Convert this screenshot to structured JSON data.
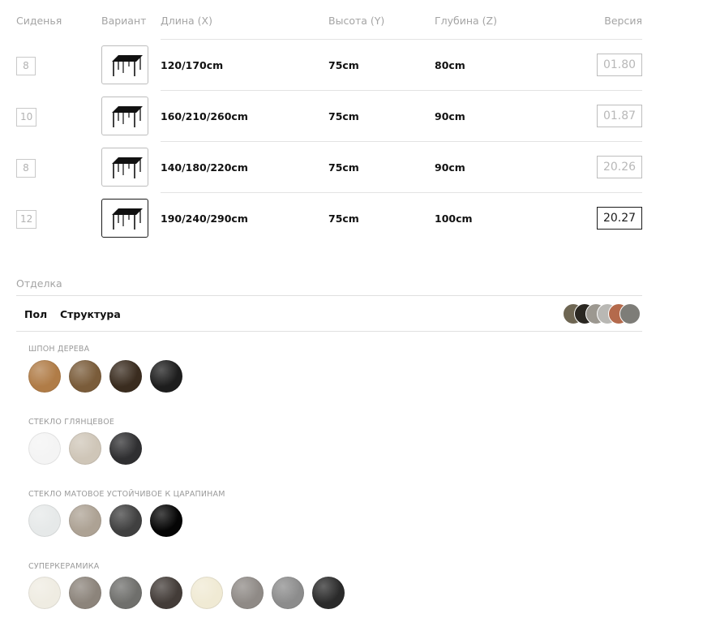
{
  "columns": {
    "seats": "Сиденья",
    "variant": "Вариант",
    "length": "Длина (X)",
    "height": "Высота (Y)",
    "depth": "Глубина (Z)",
    "version": "Версия"
  },
  "rows": [
    {
      "seats": "8",
      "length": "120/170cm",
      "height": "75cm",
      "depth": "80cm",
      "version": "01.80",
      "selected": false
    },
    {
      "seats": "10",
      "length": "160/210/260cm",
      "height": "75cm",
      "depth": "90cm",
      "version": "01.87",
      "selected": false
    },
    {
      "seats": "8",
      "length": "140/180/220cm",
      "height": "75cm",
      "depth": "90cm",
      "version": "20.26",
      "selected": false
    },
    {
      "seats": "12",
      "length": "190/240/290cm",
      "height": "75cm",
      "depth": "100cm",
      "version": "20.27",
      "selected": true
    }
  ],
  "finish": {
    "title": "Отделка",
    "tabs": [
      {
        "label": "Пол",
        "active": true
      },
      {
        "label": "Структура",
        "active": false
      }
    ],
    "preview_colors": [
      "#6e6653",
      "#2a2721",
      "#9c9890",
      "#b9b8b4",
      "#b46a4c",
      "#7e7d78"
    ],
    "groups": [
      {
        "label": "шпон дерева",
        "swatches": [
          "#b07c47",
          "#7a5c3a",
          "#3a2c1f",
          "#1d1d1d"
        ]
      },
      {
        "label": "стекло глянцевое",
        "swatches": [
          "#f4f4f4",
          "#cfc6b8",
          "#2f2f31"
        ]
      },
      {
        "label": "стекло матовое устойчивое к царапинам",
        "swatches": [
          "#e6e9e9",
          "#ada294",
          "#404040",
          "#050505"
        ]
      },
      {
        "label": "суперкерамика",
        "swatches": [
          "#efece2",
          "#8c847b",
          "#6f6f6c",
          "#433c38",
          "#f0ead4",
          "#8f8a86",
          "#8c8c8c",
          "#2a2a2a"
        ]
      }
    ]
  }
}
